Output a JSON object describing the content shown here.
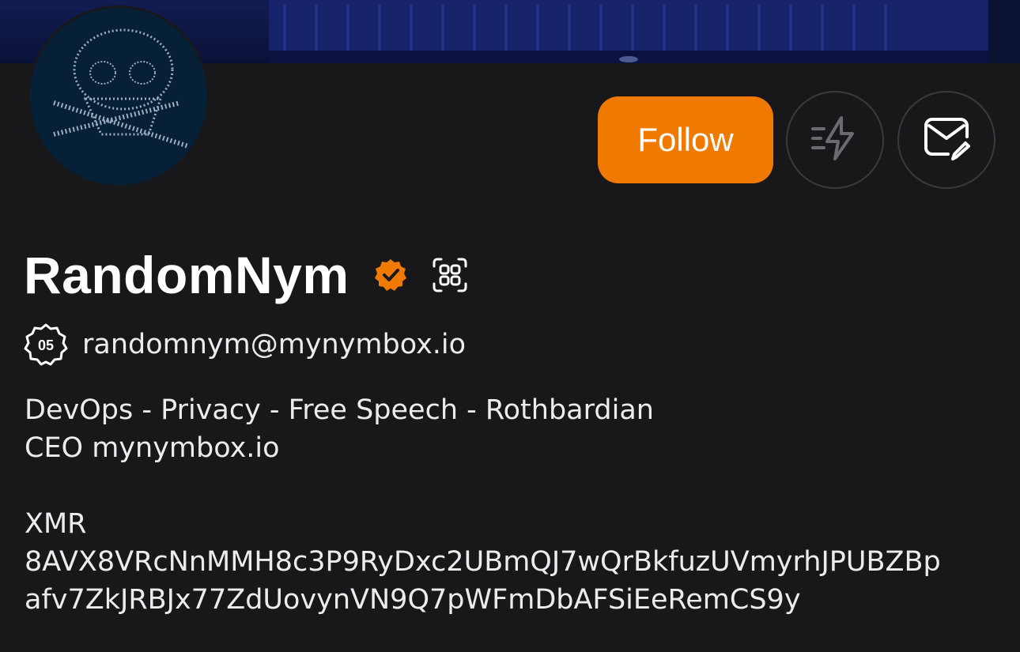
{
  "profile": {
    "display_name": "RandomNym",
    "nip05": "randomnym@mynymbox.io",
    "nip05_badge_text": "05",
    "verified_icon": "verified-check-icon",
    "qr_icon": "qr-code-icon",
    "bio_lines": [
      "DevOps - Privacy - Free Speech - Rothbardian",
      "CEO mynymbox.io",
      "",
      "XMR",
      "8AVX8VRcNnMMH8c3P9RyDxc2UBmQJ7wQrBkfuzUVmyrhJPUBZBp",
      "afv7ZkJRBJx77ZdUovynVN9Q7pWFmDbAFSiEeRemCS9y"
    ]
  },
  "actions": {
    "follow_label": "Follow",
    "zap_icon": "zap-lightning-icon",
    "message_icon": "message-edit-icon"
  },
  "colors": {
    "accent": "#f07a00",
    "background": "#18181b",
    "text": "#f2f2f2"
  }
}
